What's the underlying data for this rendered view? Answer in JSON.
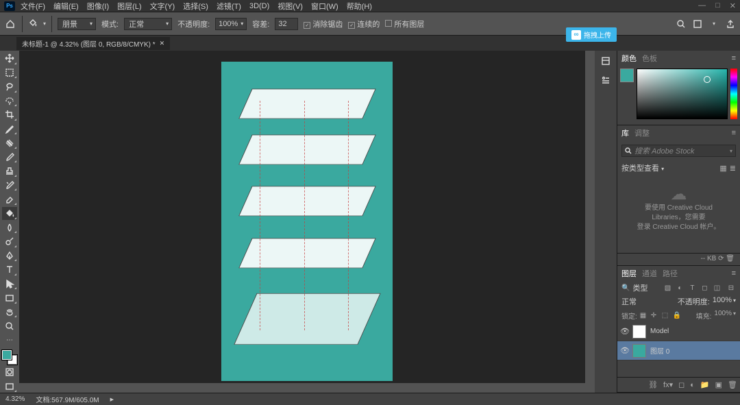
{
  "menu": {
    "items": [
      "文件(F)",
      "编辑(E)",
      "图像(I)",
      "图层(L)",
      "文字(Y)",
      "选择(S)",
      "滤镜(T)",
      "3D(D)",
      "视图(V)",
      "窗口(W)",
      "帮助(H)"
    ]
  },
  "opt": {
    "brush_label": "朋景",
    "mode_label": "模式:",
    "mode_value": "正常",
    "opacity_label": "不透明度:",
    "opacity_value": "100%",
    "tolerance_label": "容差:",
    "tolerance_value": "32",
    "antialias": "消除锯齿",
    "contiguous": "连续的",
    "all_layers": "所有图层"
  },
  "tab": {
    "title": "未标题-1 @ 4.32% (图层 0, RGB/8/CMYK) *"
  },
  "upload": "拖拽上传",
  "color_panel": {
    "tab1": "颜色",
    "tab2": "色板"
  },
  "lib_panel": {
    "tab1": "库",
    "tab2": "调整",
    "search_ph": "搜索 Adobe Stock",
    "type_label": "按类型查看",
    "msg1": "要使用 Creative Cloud Libraries，您需要",
    "msg2": "登录 Creative Cloud 帐户。"
  },
  "kb": "-- KB",
  "layers": {
    "tabs": [
      "图层",
      "通道",
      "路径"
    ],
    "kind": "类型",
    "blend": "正常",
    "opacity_label": "不透明度:",
    "opacity": "100%",
    "lock_label": "锁定:",
    "fill_label": "填充:",
    "fill": "100%",
    "items": [
      {
        "name": "Model"
      },
      {
        "name": "图层 0"
      }
    ]
  },
  "status": {
    "zoom": "4.32%",
    "doc": "文档:567.9M/605.0M"
  }
}
